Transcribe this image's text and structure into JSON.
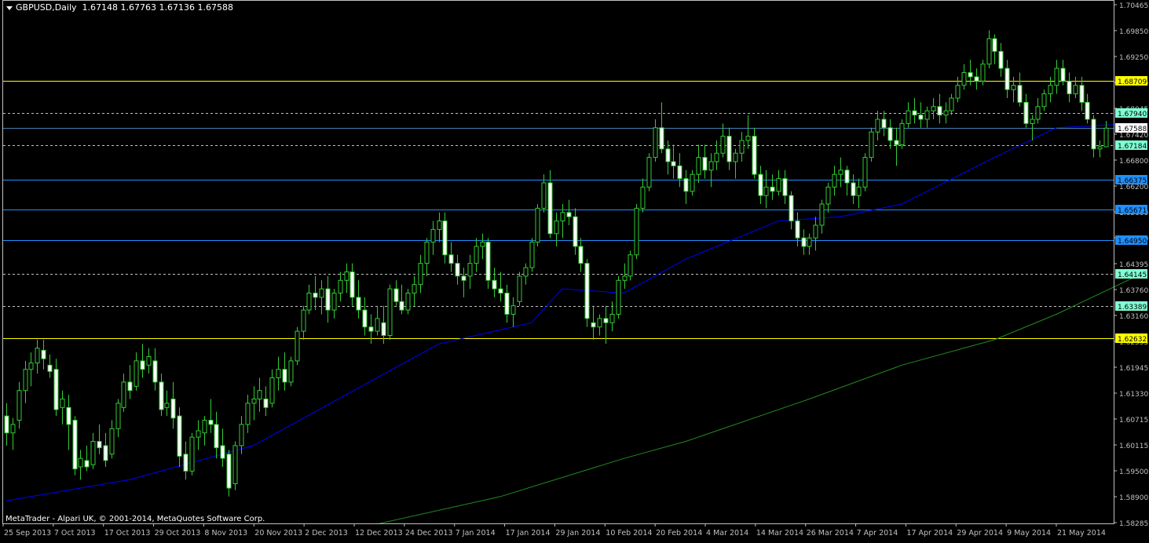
{
  "title": {
    "symbol": "GBPUSD,Daily",
    "ohlc": "1.67148 1.67763 1.67136 1.67588"
  },
  "copyright": "MetaTrader - Alpari UK, © 2001-2014, MetaQuotes Software Corp.",
  "colors": {
    "background": "#000000",
    "frame": "#c0c0c0",
    "bull_candle": "#000000",
    "bear_candle": "#ffffff",
    "wick": "#32cd32",
    "ma_short": "#0000ff",
    "ma_long": "#228b22"
  },
  "chart_data": {
    "type": "candlestick",
    "ylim": [
      1.58285,
      1.70465
    ],
    "y_ticks": [
      "1.70465",
      "1.69850",
      "1.69250",
      "1.68650",
      "1.68045",
      "1.67420",
      "1.66800",
      "1.66200",
      "1.65600",
      "1.65000",
      "1.64395",
      "1.63760",
      "1.63160",
      "1.62555",
      "1.61945",
      "1.61330",
      "1.60715",
      "1.60115",
      "1.59500",
      "1.58900",
      "1.58285"
    ],
    "x_ticks": [
      "25 Sep 2013",
      "7 Oct 2013",
      "17 Oct 2013",
      "29 Oct 2013",
      "8 Nov 2013",
      "20 Nov 2013",
      "2 Dec 2013",
      "12 Dec 2013",
      "24 Dec 2013",
      "7 Jan 2014",
      "17 Jan 2014",
      "29 Jan 2014",
      "10 Feb 2014",
      "20 Feb 2014",
      "4 Mar 2014",
      "14 Mar 2014",
      "26 Mar 2014",
      "7 Apr 2014",
      "17 Apr 2014",
      "29 Apr 2014",
      "9 May 2014",
      "21 May 2014"
    ],
    "current_price": "1.67588",
    "levels": [
      {
        "label": "1.68709",
        "value": 1.68709,
        "style": "solid",
        "color": "#ffff00",
        "badge_bg": "#ffff00"
      },
      {
        "label": "1.67940",
        "value": 1.6794,
        "style": "dashed",
        "color": "#c0c0c0",
        "badge_bg": "#7fffd4"
      },
      {
        "label": "1.67588",
        "value": 1.67588,
        "style": "solid",
        "color": "#4682b4",
        "badge_bg": "#ffffff"
      },
      {
        "label": "1.67184",
        "value": 1.67184,
        "style": "dashed",
        "color": "#c0c0c0",
        "badge_bg": "#7fffd4"
      },
      {
        "label": "1.66375",
        "value": 1.66375,
        "style": "solid",
        "color": "#1e90ff",
        "badge_bg": "#1e90ff"
      },
      {
        "label": "1.65671",
        "value": 1.65671,
        "style": "solid",
        "color": "#1e90ff",
        "badge_bg": "#1e90ff"
      },
      {
        "label": "1.64950",
        "value": 1.6495,
        "style": "solid",
        "color": "#1e90ff",
        "badge_bg": "#1e90ff"
      },
      {
        "label": "1.64145",
        "value": 1.64145,
        "style": "dashed",
        "color": "#c0c0c0",
        "badge_bg": "#7fffd4"
      },
      {
        "label": "1.63389",
        "value": 1.63389,
        "style": "dashed",
        "color": "#c0c0c0",
        "badge_bg": "#7fffd4"
      },
      {
        "label": "1.62632",
        "value": 1.62632,
        "style": "solid",
        "color": "#ffff00",
        "badge_bg": "#ffff00"
      }
    ],
    "candles": [
      [
        1.608,
        1.611,
        1.601,
        1.604
      ],
      [
        1.604,
        1.6075,
        1.6,
        1.606
      ],
      [
        1.607,
        1.616,
        1.605,
        1.614
      ],
      [
        1.614,
        1.621,
        1.611,
        1.619
      ],
      [
        1.619,
        1.623,
        1.615,
        1.6205
      ],
      [
        1.6205,
        1.626,
        1.618,
        1.624
      ],
      [
        1.6235,
        1.626,
        1.619,
        1.6215
      ],
      [
        1.62,
        1.6225,
        1.617,
        1.6185
      ],
      [
        1.619,
        1.6215,
        1.608,
        1.6095
      ],
      [
        1.61,
        1.614,
        1.606,
        1.612
      ],
      [
        1.61,
        1.613,
        1.6,
        1.606
      ],
      [
        1.607,
        1.608,
        1.594,
        1.5955
      ],
      [
        1.596,
        1.6,
        1.593,
        1.598
      ],
      [
        1.5975,
        1.601,
        1.595,
        1.596
      ],
      [
        1.5965,
        1.604,
        1.5955,
        1.602
      ],
      [
        1.602,
        1.606,
        1.599,
        1.6005
      ],
      [
        1.601,
        1.604,
        1.596,
        1.5975
      ],
      [
        1.599,
        1.607,
        1.598,
        1.605
      ],
      [
        1.605,
        1.612,
        1.603,
        1.611
      ],
      [
        1.61,
        1.618,
        1.609,
        1.616
      ],
      [
        1.616,
        1.62,
        1.612,
        1.614
      ],
      [
        1.615,
        1.623,
        1.614,
        1.621
      ],
      [
        1.621,
        1.625,
        1.617,
        1.619
      ],
      [
        1.62,
        1.624,
        1.618,
        1.622
      ],
      [
        1.621,
        1.624,
        1.614,
        1.616
      ],
      [
        1.616,
        1.618,
        1.608,
        1.6095
      ],
      [
        1.61,
        1.614,
        1.608,
        1.611
      ],
      [
        1.612,
        1.616,
        1.605,
        1.6075
      ],
      [
        1.608,
        1.61,
        1.596,
        1.5985
      ],
      [
        1.599,
        1.602,
        1.593,
        1.595
      ],
      [
        1.595,
        1.604,
        1.594,
        1.603
      ],
      [
        1.603,
        1.607,
        1.6,
        1.6045
      ],
      [
        1.604,
        1.608,
        1.601,
        1.607
      ],
      [
        1.607,
        1.612,
        1.604,
        1.606
      ],
      [
        1.606,
        1.609,
        1.598,
        1.6005
      ],
      [
        1.601,
        1.605,
        1.596,
        1.598
      ],
      [
        1.599,
        1.6,
        1.589,
        1.591
      ],
      [
        1.592,
        1.602,
        1.5905,
        1.601
      ],
      [
        1.601,
        1.608,
        1.599,
        1.606
      ],
      [
        1.606,
        1.613,
        1.604,
        1.611
      ],
      [
        1.611,
        1.615,
        1.607,
        1.612
      ],
      [
        1.612,
        1.617,
        1.609,
        1.614
      ],
      [
        1.612,
        1.615,
        1.608,
        1.61
      ],
      [
        1.611,
        1.619,
        1.61,
        1.617
      ],
      [
        1.617,
        1.622,
        1.614,
        1.619
      ],
      [
        1.619,
        1.623,
        1.614,
        1.616
      ],
      [
        1.616,
        1.622,
        1.615,
        1.621
      ],
      [
        1.621,
        1.629,
        1.62,
        1.628
      ],
      [
        1.628,
        1.634,
        1.626,
        1.633
      ],
      [
        1.633,
        1.639,
        1.632,
        1.637
      ],
      [
        1.637,
        1.641,
        1.633,
        1.636
      ],
      [
        1.636,
        1.64,
        1.632,
        1.638
      ],
      [
        1.638,
        1.641,
        1.63,
        1.633
      ],
      [
        1.633,
        1.638,
        1.631,
        1.637
      ],
      [
        1.637,
        1.642,
        1.635,
        1.64
      ],
      [
        1.64,
        1.644,
        1.637,
        1.642
      ],
      [
        1.642,
        1.644,
        1.634,
        1.636
      ],
      [
        1.636,
        1.64,
        1.631,
        1.633
      ],
      [
        1.633,
        1.636,
        1.627,
        1.629
      ],
      [
        1.629,
        1.632,
        1.625,
        1.628
      ],
      [
        1.628,
        1.634,
        1.627,
        1.631
      ],
      [
        1.63,
        1.634,
        1.625,
        1.627
      ],
      [
        1.627,
        1.639,
        1.626,
        1.638
      ],
      [
        1.638,
        1.64,
        1.634,
        1.635
      ],
      [
        1.635,
        1.639,
        1.632,
        1.633
      ],
      [
        1.633,
        1.638,
        1.632,
        1.637
      ],
      [
        1.637,
        1.641,
        1.634,
        1.639
      ],
      [
        1.639,
        1.646,
        1.637,
        1.644
      ],
      [
        1.644,
        1.65,
        1.641,
        1.649
      ],
      [
        1.649,
        1.654,
        1.646,
        1.652
      ],
      [
        1.652,
        1.656,
        1.649,
        1.654
      ],
      [
        1.654,
        1.656,
        1.644,
        1.646
      ],
      [
        1.646,
        1.649,
        1.642,
        1.644
      ],
      [
        1.644,
        1.646,
        1.639,
        1.641
      ],
      [
        1.641,
        1.643,
        1.636,
        1.64
      ],
      [
        1.641,
        1.646,
        1.638,
        1.644
      ],
      [
        1.644,
        1.65,
        1.642,
        1.648
      ],
      [
        1.648,
        1.651,
        1.645,
        1.649
      ],
      [
        1.649,
        1.65,
        1.638,
        1.64
      ],
      [
        1.64,
        1.643,
        1.636,
        1.638
      ],
      [
        1.638,
        1.642,
        1.635,
        1.637
      ],
      [
        1.637,
        1.639,
        1.63,
        1.632
      ],
      [
        1.632,
        1.636,
        1.629,
        1.634
      ],
      [
        1.635,
        1.642,
        1.634,
        1.641
      ],
      [
        1.641,
        1.644,
        1.639,
        1.643
      ],
      [
        1.643,
        1.65,
        1.642,
        1.649
      ],
      [
        1.649,
        1.658,
        1.648,
        1.657
      ],
      [
        1.657,
        1.665,
        1.656,
        1.663
      ],
      [
        1.663,
        1.666,
        1.65,
        1.651
      ],
      [
        1.651,
        1.656,
        1.648,
        1.654
      ],
      [
        1.654,
        1.658,
        1.65,
        1.656
      ],
      [
        1.656,
        1.659,
        1.653,
        1.655
      ],
      [
        1.655,
        1.657,
        1.646,
        1.648
      ],
      [
        1.648,
        1.65,
        1.642,
        1.644
      ],
      [
        1.644,
        1.645,
        1.629,
        1.631
      ],
      [
        1.63,
        1.634,
        1.626,
        1.629
      ],
      [
        1.629,
        1.632,
        1.627,
        1.631
      ],
      [
        1.631,
        1.634,
        1.625,
        1.63
      ],
      [
        1.63,
        1.635,
        1.628,
        1.632
      ],
      [
        1.632,
        1.641,
        1.631,
        1.64
      ],
      [
        1.64,
        1.644,
        1.638,
        1.641
      ],
      [
        1.641,
        1.647,
        1.64,
        1.646
      ],
      [
        1.646,
        1.658,
        1.645,
        1.657
      ],
      [
        1.657,
        1.664,
        1.656,
        1.662
      ],
      [
        1.662,
        1.67,
        1.661,
        1.669
      ],
      [
        1.669,
        1.678,
        1.668,
        1.676
      ],
      [
        1.676,
        1.682,
        1.67,
        1.671
      ],
      [
        1.671,
        1.673,
        1.665,
        1.668
      ],
      [
        1.668,
        1.672,
        1.664,
        1.667
      ],
      [
        1.667,
        1.67,
        1.662,
        1.664
      ],
      [
        1.664,
        1.666,
        1.658,
        1.661
      ],
      [
        1.661,
        1.666,
        1.66,
        1.665
      ],
      [
        1.665,
        1.672,
        1.663,
        1.669
      ],
      [
        1.669,
        1.672,
        1.664,
        1.666
      ],
      [
        1.666,
        1.67,
        1.662,
        1.668
      ],
      [
        1.668,
        1.673,
        1.666,
        1.67
      ],
      [
        1.67,
        1.677,
        1.669,
        1.674
      ],
      [
        1.674,
        1.676,
        1.666,
        1.668
      ],
      [
        1.668,
        1.671,
        1.664,
        1.67
      ],
      [
        1.67,
        1.675,
        1.668,
        1.673
      ],
      [
        1.673,
        1.679,
        1.671,
        1.674
      ],
      [
        1.674,
        1.676,
        1.664,
        1.665
      ],
      [
        1.665,
        1.667,
        1.658,
        1.66
      ],
      [
        1.66,
        1.666,
        1.657,
        1.662
      ],
      [
        1.662,
        1.665,
        1.659,
        1.661
      ],
      [
        1.661,
        1.666,
        1.66,
        1.664
      ],
      [
        1.664,
        1.666,
        1.658,
        1.66
      ],
      [
        1.66,
        1.661,
        1.652,
        1.654
      ],
      [
        1.654,
        1.656,
        1.648,
        1.65
      ],
      [
        1.65,
        1.652,
        1.646,
        1.648
      ],
      [
        1.648,
        1.651,
        1.646,
        1.65
      ],
      [
        1.65,
        1.655,
        1.647,
        1.653
      ],
      [
        1.653,
        1.659,
        1.651,
        1.658
      ],
      [
        1.658,
        1.663,
        1.656,
        1.662
      ],
      [
        1.662,
        1.667,
        1.66,
        1.665
      ],
      [
        1.665,
        1.669,
        1.662,
        1.666
      ],
      [
        1.666,
        1.667,
        1.66,
        1.663
      ],
      [
        1.663,
        1.665,
        1.658,
        1.66
      ],
      [
        1.66,
        1.664,
        1.657,
        1.662
      ],
      [
        1.662,
        1.67,
        1.661,
        1.669
      ],
      [
        1.669,
        1.676,
        1.668,
        1.675
      ],
      [
        1.675,
        1.68,
        1.673,
        1.678
      ],
      [
        1.678,
        1.68,
        1.674,
        1.676
      ],
      [
        1.676,
        1.678,
        1.671,
        1.673
      ],
      [
        1.673,
        1.676,
        1.667,
        1.672
      ],
      [
        1.672,
        1.678,
        1.671,
        1.677
      ],
      [
        1.677,
        1.682,
        1.676,
        1.68
      ],
      [
        1.68,
        1.683,
        1.677,
        1.679
      ],
      [
        1.679,
        1.682,
        1.676,
        1.678
      ],
      [
        1.678,
        1.681,
        1.676,
        1.68
      ],
      [
        1.68,
        1.683,
        1.678,
        1.681
      ],
      [
        1.681,
        1.684,
        1.677,
        1.679
      ],
      [
        1.679,
        1.682,
        1.677,
        1.68
      ],
      [
        1.68,
        1.684,
        1.679,
        1.683
      ],
      [
        1.683,
        1.688,
        1.682,
        1.686
      ],
      [
        1.686,
        1.691,
        1.685,
        1.689
      ],
      [
        1.689,
        1.692,
        1.686,
        1.688
      ],
      [
        1.688,
        1.69,
        1.685,
        1.687
      ],
      [
        1.687,
        1.692,
        1.686,
        1.691
      ],
      [
        1.691,
        1.699,
        1.69,
        1.697
      ],
      [
        1.697,
        1.698,
        1.691,
        1.694
      ],
      [
        1.694,
        1.696,
        1.688,
        1.69
      ],
      [
        1.69,
        1.692,
        1.683,
        1.685
      ],
      [
        1.685,
        1.688,
        1.682,
        1.686
      ],
      [
        1.686,
        1.689,
        1.681,
        1.682
      ],
      [
        1.682,
        1.684,
        1.676,
        1.677
      ],
      [
        1.677,
        1.679,
        1.673,
        1.678
      ],
      [
        1.678,
        1.683,
        1.677,
        1.681
      ],
      [
        1.681,
        1.685,
        1.68,
        1.684
      ],
      [
        1.684,
        1.688,
        1.682,
        1.686
      ],
      [
        1.686,
        1.692,
        1.684,
        1.69
      ],
      [
        1.69,
        1.692,
        1.686,
        1.687
      ],
      [
        1.687,
        1.689,
        1.682,
        1.684
      ],
      [
        1.684,
        1.688,
        1.683,
        1.686
      ],
      [
        1.686,
        1.688,
        1.68,
        1.682
      ],
      [
        1.682,
        1.684,
        1.677,
        1.678
      ],
      [
        1.678,
        1.679,
        1.669,
        1.671
      ],
      [
        1.671,
        1.673,
        1.669,
        1.6715
      ],
      [
        1.6715,
        1.6776,
        1.6714,
        1.6759
      ]
    ],
    "ma_short": [
      [
        0,
        1.588
      ],
      [
        20,
        1.593
      ],
      [
        40,
        1.601
      ],
      [
        55,
        1.613
      ],
      [
        70,
        1.625
      ],
      [
        85,
        1.63
      ],
      [
        90,
        1.638
      ],
      [
        100,
        1.637
      ],
      [
        110,
        1.645
      ],
      [
        125,
        1.654
      ],
      [
        135,
        1.655
      ],
      [
        145,
        1.658
      ],
      [
        160,
        1.669
      ],
      [
        170,
        1.676
      ],
      [
        183,
        1.677
      ]
    ],
    "ma_long": [
      [
        60,
        1.5825
      ],
      [
        80,
        1.589
      ],
      [
        100,
        1.598
      ],
      [
        110,
        1.602
      ],
      [
        130,
        1.612
      ],
      [
        145,
        1.62
      ],
      [
        160,
        1.626
      ],
      [
        170,
        1.632
      ],
      [
        183,
        1.641
      ]
    ]
  }
}
